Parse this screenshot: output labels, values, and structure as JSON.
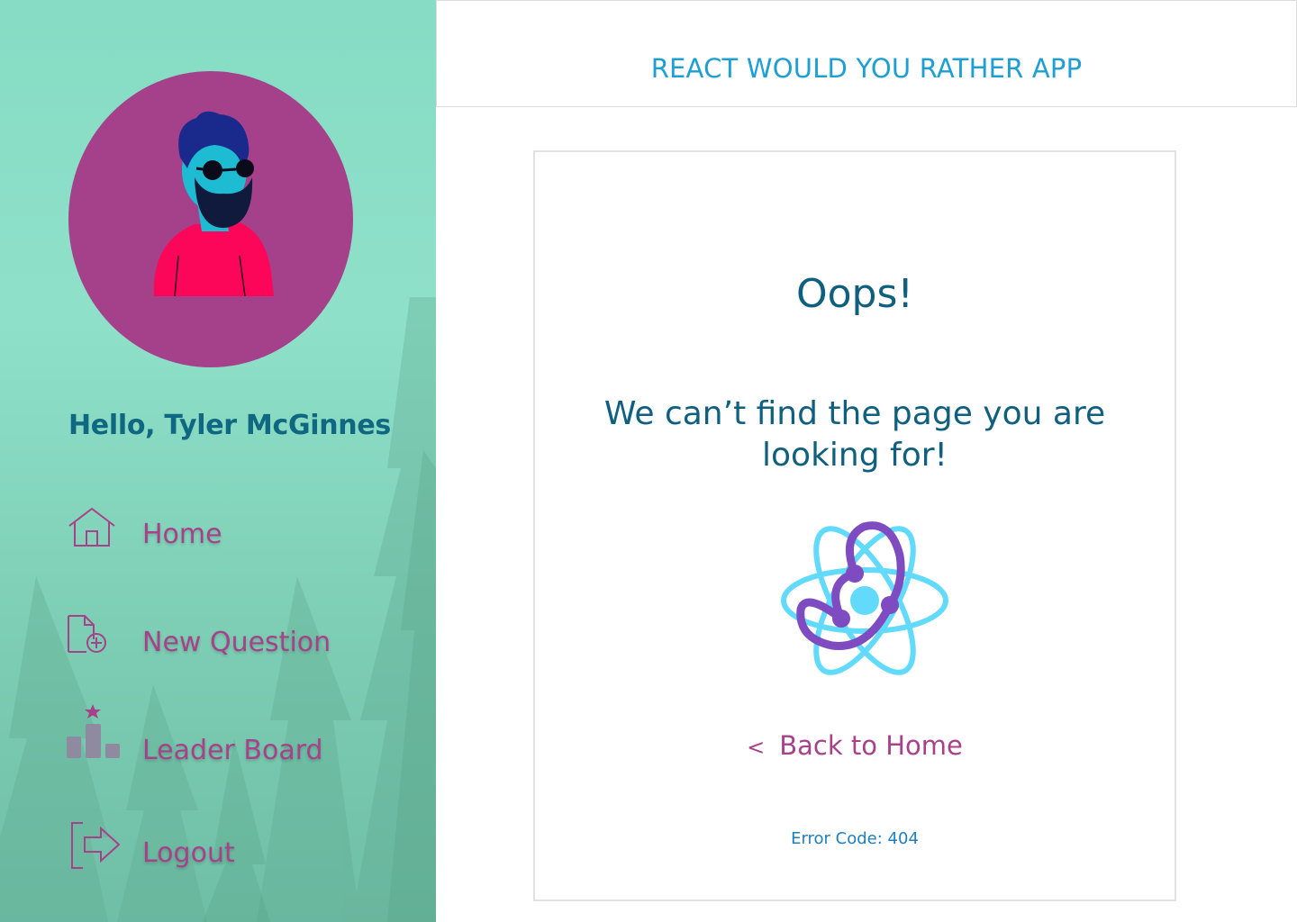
{
  "app": {
    "title": "REACT WOULD YOU RATHER APP"
  },
  "sidebar": {
    "greeting": "Hello, Tyler McGinnes",
    "avatar_icon": "bearded-man-avatar",
    "items": [
      {
        "label": "Home",
        "icon": "home-icon"
      },
      {
        "label": "New Question",
        "icon": "new-document-icon"
      },
      {
        "label": "Leader Board",
        "icon": "leaderboard-icon"
      },
      {
        "label": "Logout",
        "icon": "logout-icon"
      }
    ]
  },
  "not_found": {
    "heading": "Oops!",
    "message": "We can’t find the page you are looking for!",
    "back_chevron": "<",
    "back_label": "Back to Home",
    "error_code": "Error Code: 404",
    "logo_icon": "react-atom-icon"
  },
  "colors": {
    "sidebar_bg": "#8fe0c9",
    "accent_pink": "#a7428a",
    "title_blue": "#1d9fd4",
    "text_dark_teal": "#0f5f7f",
    "react_cyan": "#61dafb",
    "react_purple": "#7e4cc0"
  }
}
